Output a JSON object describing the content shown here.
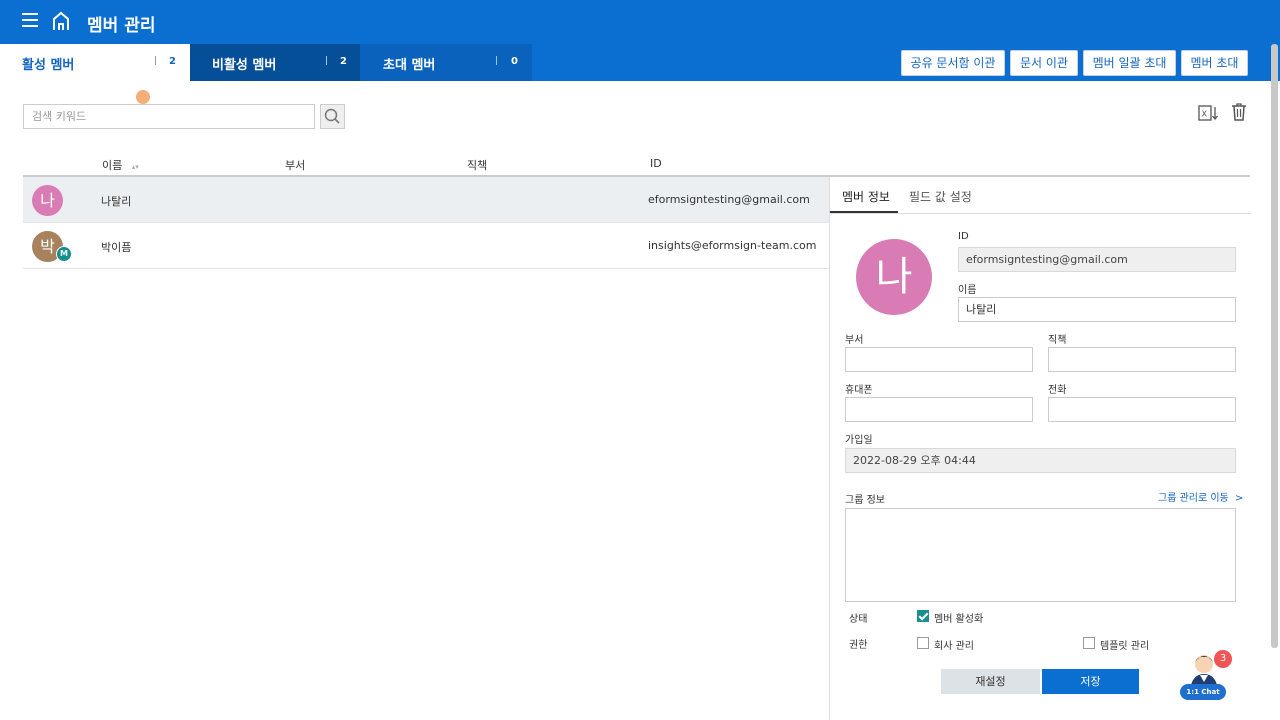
{
  "header": {
    "title": "멤버 관리",
    "menu_icon": "hamburger-menu-icon",
    "home_icon": "home-icon",
    "color": "#0a6fd1"
  },
  "tabs": [
    {
      "label": "활성 멤버",
      "count": "2",
      "active": true
    },
    {
      "label": "비활성 멤버",
      "count": "2",
      "active": false
    },
    {
      "label": "초대 멤버",
      "count": "0",
      "active": false
    }
  ],
  "actions": {
    "transfer_shared_box": "공유 문서함 이관",
    "transfer_documents": "문서 이관",
    "bulk_invite": "멤버 일괄 초대",
    "invite": "멤버 초대"
  },
  "search": {
    "placeholder": "검색 키워드",
    "icon": "search-icon"
  },
  "table": {
    "columns": [
      "이름",
      "부서",
      "직책",
      "ID"
    ],
    "rows": [
      {
        "avatar": "나",
        "avatar_color": "#d97bb4",
        "name": "나탈리",
        "department": "",
        "position": "",
        "id": "eformsigntesting@gmail.com",
        "selected": true
      },
      {
        "avatar": "박",
        "avatar_color": "#a8825d",
        "badge": "M",
        "name": "박이픔",
        "department": "",
        "position": "",
        "id": "insights@eformsign-team.com",
        "selected": false
      }
    ]
  },
  "panel": {
    "tabs": [
      "멤버 정보",
      "필드 값 설정"
    ],
    "avatar": "나",
    "id_label": "ID",
    "id_value": "eformsigntesting@gmail.com",
    "name_label": "이름",
    "name_value": "나탈리",
    "department_label": "부서",
    "department_value": "",
    "position_label": "직책",
    "position_value": "",
    "mobile_label": "휴대폰",
    "mobile_value": "",
    "phone_label": "전화",
    "phone_value": "",
    "joined_label": "가입일",
    "joined_value": "2022-08-29 오후 04:44",
    "group_label": "그룹 정보",
    "group_link": "그룹 관리로 이동",
    "status_label": "상태",
    "status_option": "멤버 활성화",
    "status_checked": true,
    "permission_label": "권한",
    "perm_company": "회사 관리",
    "perm_company_checked": false,
    "perm_template": "템플릿 관리",
    "perm_template_checked": false,
    "reset_label": "재설정",
    "save_label": "저장"
  },
  "chat": {
    "label": "1:1 Chat",
    "unread": "3"
  }
}
